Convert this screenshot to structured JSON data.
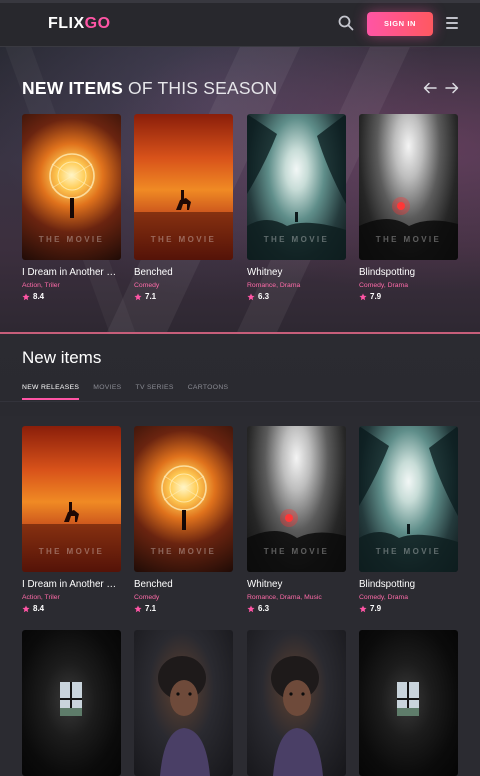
{
  "header": {
    "logo_part1": "FLIX",
    "logo_part2": "GO",
    "signin_label": "SIGN IN",
    "accent": "#ff55a5"
  },
  "hero": {
    "title_bold": "NEW ITEMS",
    "title_rest": "OF THIS SEASON",
    "items": [
      {
        "title": "I Dream in Another Language",
        "genres": [
          "Action",
          "Triler"
        ],
        "rating": "8.4",
        "art": "sparks",
        "watermark": "THE MOVIE"
      },
      {
        "title": "Benched",
        "genres": [
          "Comedy"
        ],
        "rating": "7.1",
        "art": "sunset",
        "watermark": "THE MOVIE"
      },
      {
        "title": "Whitney",
        "genres": [
          "Romance",
          "Drama"
        ],
        "rating": "6.3",
        "art": "cave",
        "watermark": "THE MOVIE"
      },
      {
        "title": "Blindspotting",
        "genres": [
          "Comedy",
          "Drama"
        ],
        "rating": "7.9",
        "art": "smoke",
        "watermark": "THE MOVIE"
      }
    ]
  },
  "new_items": {
    "title": "New items",
    "tabs": [
      "NEW RELEASES",
      "MOVIES",
      "TV SERIES",
      "CARTOONS"
    ],
    "active_tab": "NEW RELEASES",
    "items": [
      {
        "title": "I Dream in Another Language",
        "genres": [
          "Action",
          "Triler"
        ],
        "rating": "8.4",
        "art": "sunset",
        "watermark": "THE MOVIE"
      },
      {
        "title": "Benched",
        "genres": [
          "Comedy"
        ],
        "rating": "7.1",
        "art": "sparks",
        "watermark": "THE MOVIE"
      },
      {
        "title": "Whitney",
        "genres": [
          "Romance",
          "Drama",
          "Music"
        ],
        "rating": "6.3",
        "art": "smoke",
        "watermark": "THE MOVIE"
      },
      {
        "title": "Blindspotting",
        "genres": [
          "Comedy",
          "Drama"
        ],
        "rating": "7.9",
        "art": "cave",
        "watermark": "THE MOVIE"
      }
    ],
    "second_row_art": [
      "window",
      "portrait",
      "portrait",
      "window"
    ]
  },
  "icons": {
    "search": "search-icon",
    "menu": "menu-icon",
    "prev": "arrow-left-icon",
    "next": "arrow-right-icon",
    "star": "star-icon"
  }
}
